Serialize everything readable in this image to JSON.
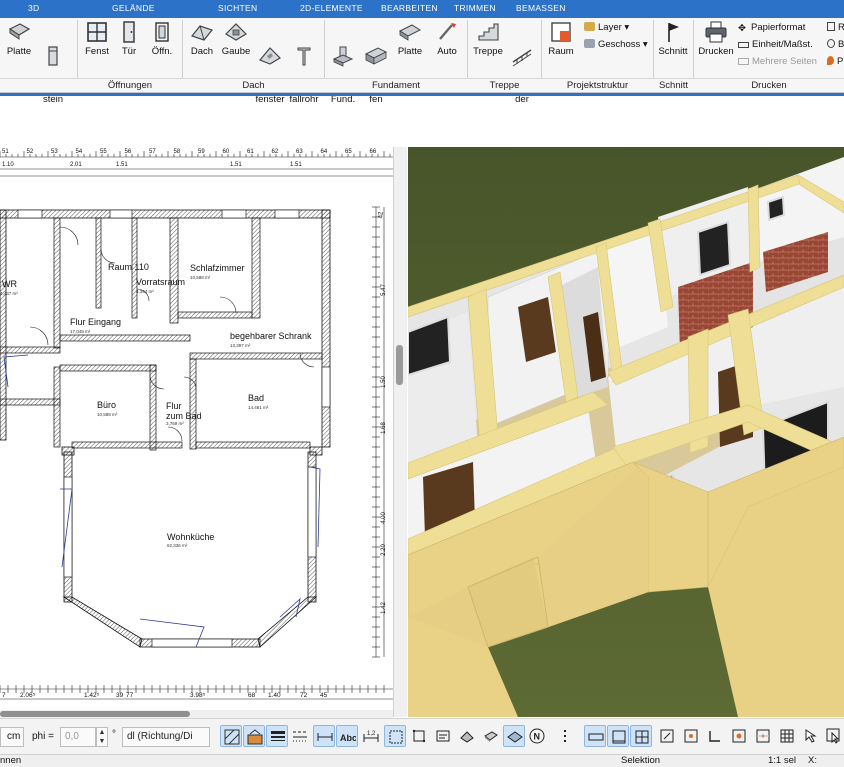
{
  "tabs": [
    "3D",
    "GELÄNDE",
    "SICHTEN",
    "2D-ELEMENTE",
    "BEARBEITEN",
    "TRIMMEN",
    "BEMASSEN"
  ],
  "ribbon": {
    "buttons": [
      {
        "label": "Platte",
        "icon": "slab-icon"
      },
      {
        "label": "Schorn-\nstein",
        "icon": "chimney-icon"
      },
      {
        "label": "Fenst",
        "icon": "window-icon"
      },
      {
        "label": "Tür",
        "icon": "door-icon"
      },
      {
        "label": "Öffn.",
        "icon": "opening-icon"
      },
      {
        "label": "Dach",
        "icon": "roof-icon"
      },
      {
        "label": "Gaube",
        "icon": "dormer-icon"
      },
      {
        "label": "Dach-\nfenster",
        "icon": "roof-window-icon"
      },
      {
        "label": "Regen-\nfallrohr",
        "icon": "downpipe-icon"
      },
      {
        "label": "Einzel\nFund.",
        "icon": "single-foundation-icon"
      },
      {
        "label": "Strei-\nfen",
        "icon": "strip-foundation-icon"
      },
      {
        "label": "Platte",
        "icon": "foundation-slab-icon"
      },
      {
        "label": "Auto",
        "icon": "auto-foundation-icon"
      },
      {
        "label": "Treppe",
        "icon": "stairs-icon"
      },
      {
        "label": "Gelän-\nder",
        "icon": "railing-icon"
      },
      {
        "label": "Raum",
        "icon": "room-icon"
      },
      {
        "label": "Schnitt",
        "icon": "section-flag-icon"
      },
      {
        "label": "Drucken",
        "icon": "printer-icon"
      }
    ],
    "layer_label": "Layer",
    "geschoss_label": "Geschoss",
    "papierformat_label": "Papierformat",
    "einheit_label": "Einheit/Maßst.",
    "mehrere_seiten_label": "Mehrere Seiten",
    "edge_labels": [
      "R",
      "B",
      "P"
    ],
    "groups": [
      "Öffnungen",
      "Dach",
      "Fundament",
      "Treppe",
      "Projektstruktur",
      "Schnitt",
      "Drucken"
    ]
  },
  "plan": {
    "rooms": [
      {
        "name": "WR",
        "area": "4,437 m²"
      },
      {
        "name": "Raum 110",
        "area": ""
      },
      {
        "name": "Vorratsraum",
        "area": "4,394 m²"
      },
      {
        "name": "Schlafzimmer",
        "area": "10,588 m²"
      },
      {
        "name": "Flur Eingang",
        "area": "17,049 m²"
      },
      {
        "name": "begehbarer Schrank",
        "area": "13,397 m²"
      },
      {
        "name": "Büro",
        "area": "10,588 m²"
      },
      {
        "name": "Flur\nzum Bad",
        "area": "3,769 m²"
      },
      {
        "name": "Bad",
        "area": "14,461 m²"
      },
      {
        "name": "Wohnküche",
        "area": "62,336 m²"
      }
    ],
    "top_ruler_numbers": [
      "51",
      "52",
      "53",
      "54",
      "55",
      "56",
      "57",
      "58",
      "59",
      "60",
      "61",
      "62",
      "63",
      "64",
      "65",
      "66"
    ],
    "top_dimensions": [
      "1.10",
      "2.01",
      "1.51",
      "1.51",
      "1.51"
    ],
    "bottom_dimensions": [
      "7",
      "2.06⁵",
      "1.42⁵",
      "39",
      "77",
      "3.98⁵",
      "68",
      "1.40",
      "72",
      "45"
    ],
    "right_dimensions": [
      "42",
      "5.47",
      "1.50",
      "1.68",
      "4.00",
      "2.20",
      "1.42"
    ]
  },
  "bottombar": {
    "unit": "cm",
    "phi_label": "phi =",
    "phi_value": "0,0",
    "degree_symbol": "°",
    "direction_select": "dl (Richtung/Di"
  },
  "status": {
    "left": "nnen",
    "mode": "Selektion",
    "scale": "1:1 sel",
    "coord": "X:"
  },
  "colors": {
    "accent": "#2b72c8",
    "wall_yellow": "#efdf96",
    "grass": "#4e5a2e",
    "door_brown": "#5a3a1e",
    "brick": "#9a4634"
  }
}
